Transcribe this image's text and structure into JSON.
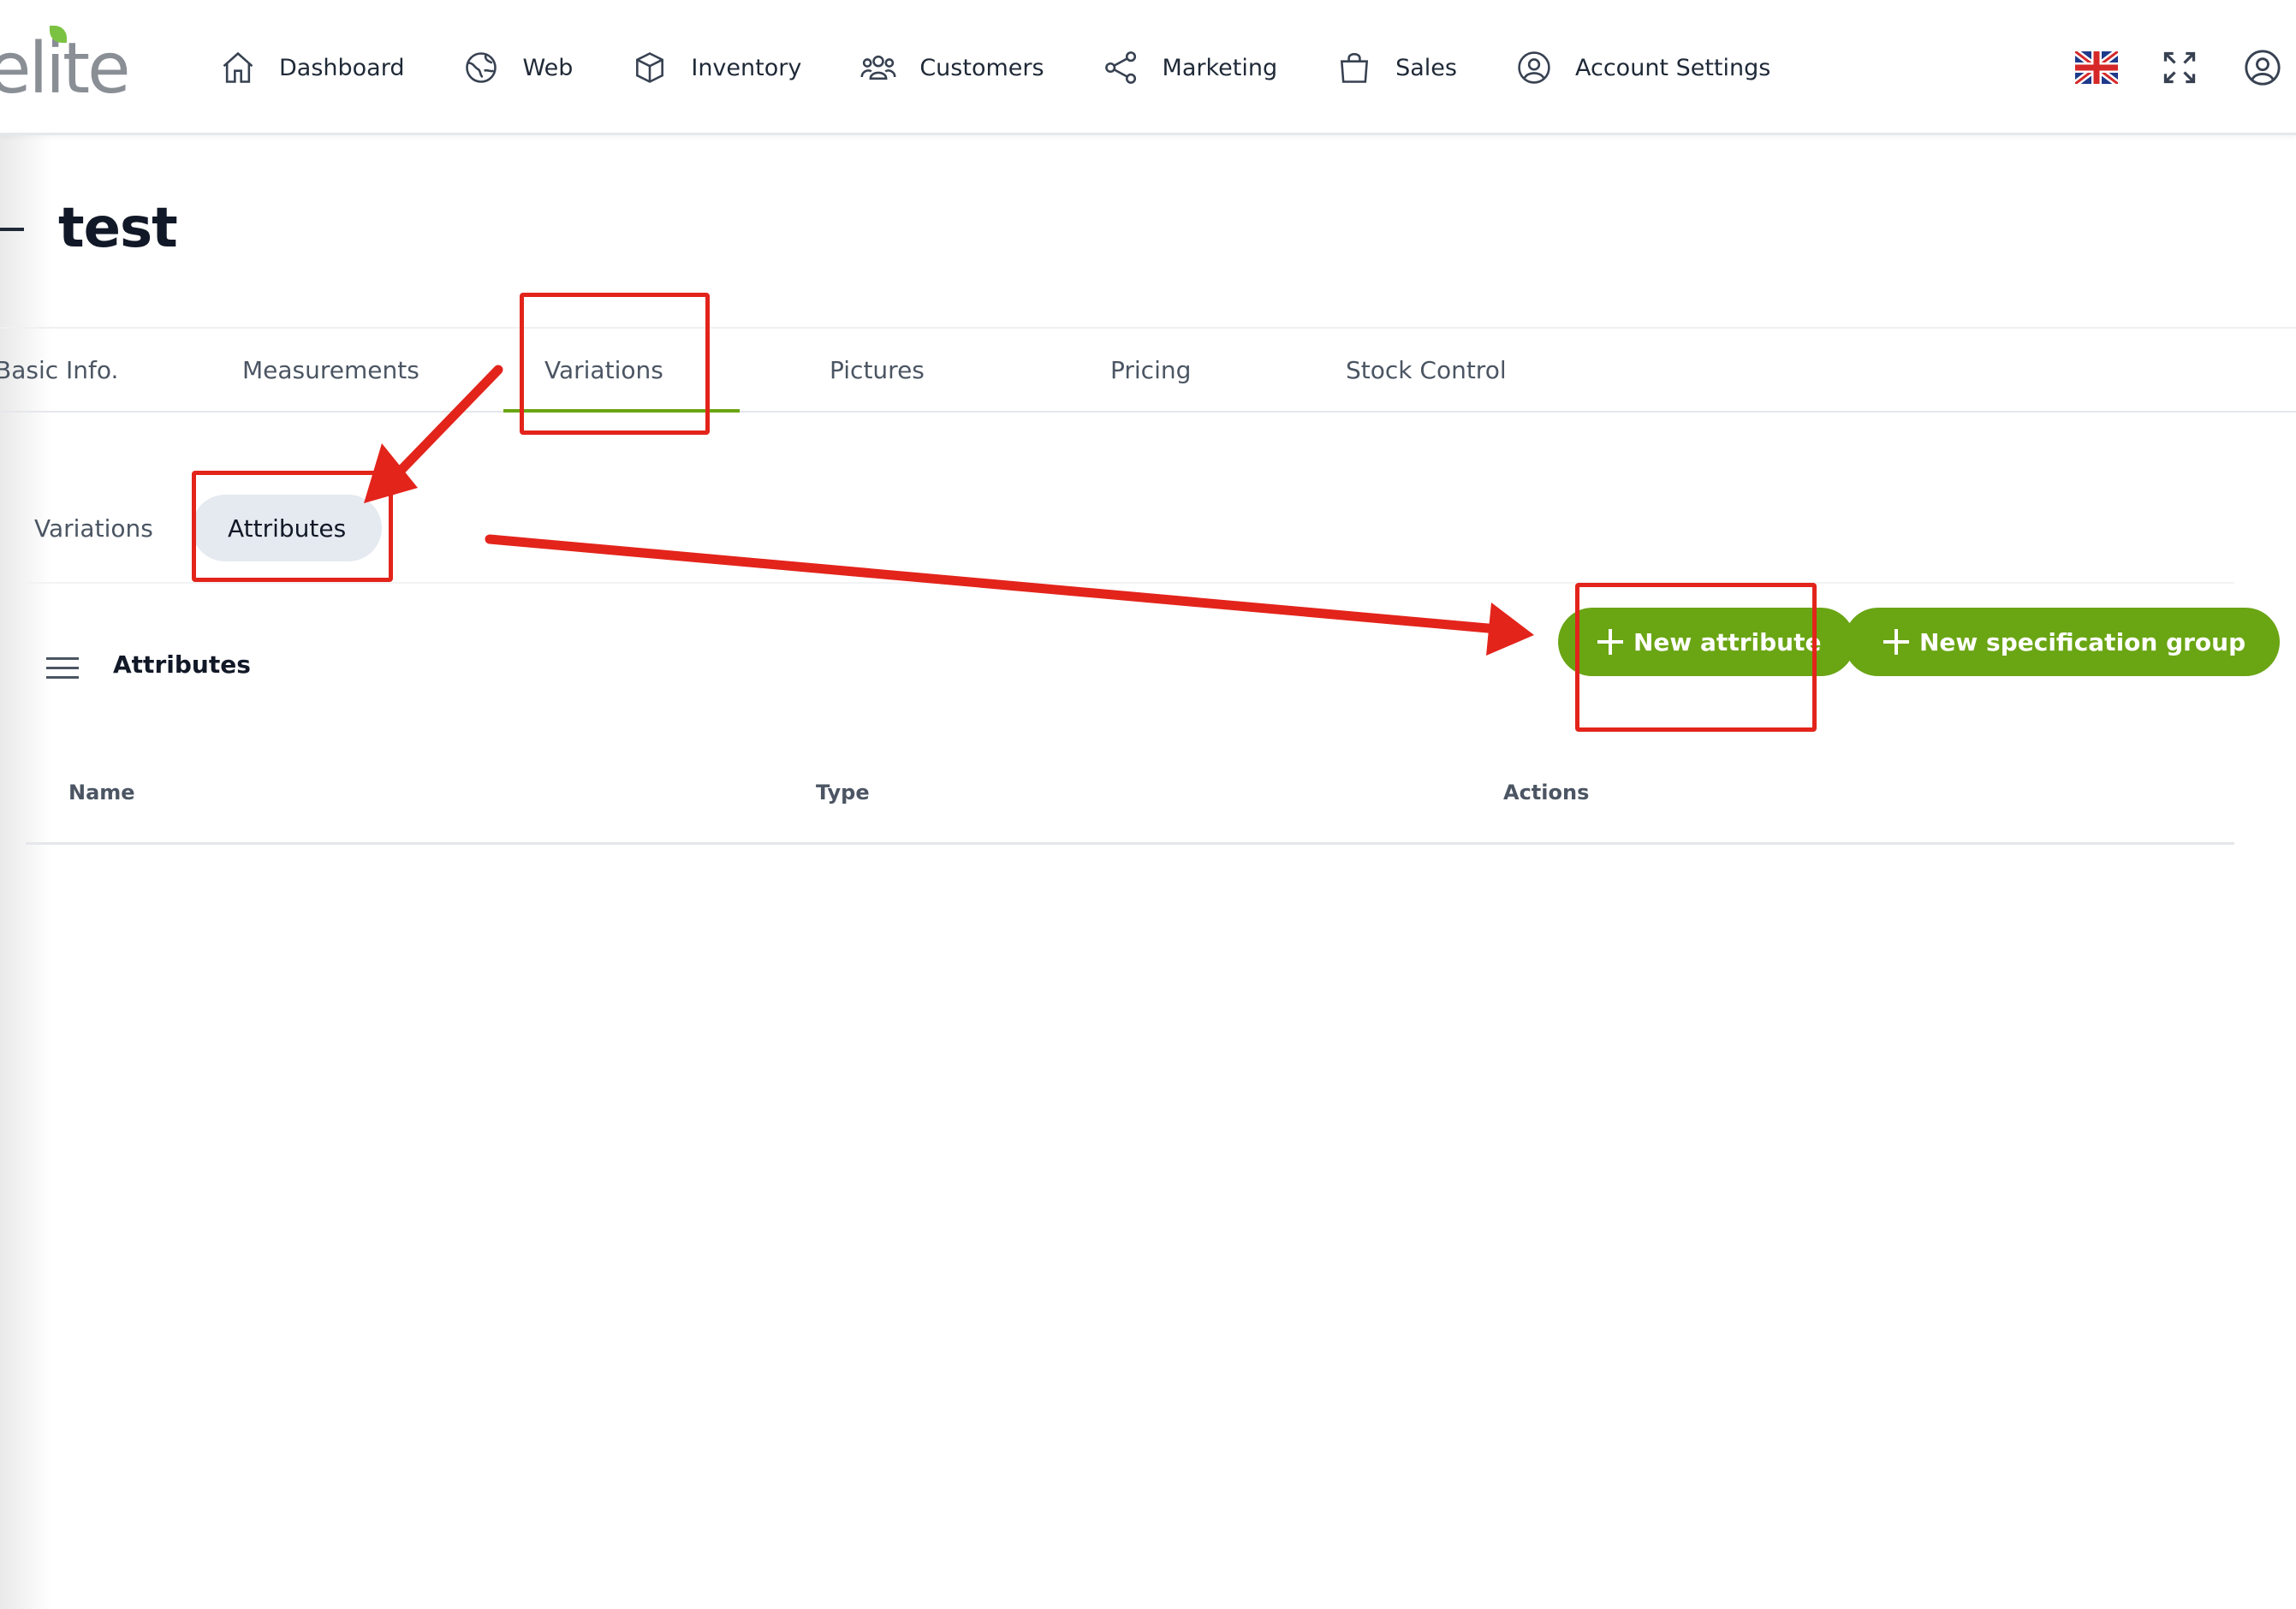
{
  "app": {
    "logo_text": "elite"
  },
  "nav": [
    {
      "label": "Dashboard",
      "icon": "home-icon"
    },
    {
      "label": "Web",
      "icon": "globe-icon"
    },
    {
      "label": "Inventory",
      "icon": "box-icon"
    },
    {
      "label": "Customers",
      "icon": "users-icon"
    },
    {
      "label": "Marketing",
      "icon": "share-icon"
    },
    {
      "label": "Sales",
      "icon": "shopping-bag-icon"
    },
    {
      "label": "Account Settings",
      "icon": "user-circle-icon"
    }
  ],
  "top_right": {
    "language_icon": "uk-flag-icon",
    "fullscreen_icon": "expand-icon",
    "account_icon": "user-circle-icon"
  },
  "page": {
    "title": "test"
  },
  "tabs": [
    {
      "label": "Basic Info."
    },
    {
      "label": "Measurements"
    },
    {
      "label": "Variations",
      "active": true
    },
    {
      "label": "Pictures"
    },
    {
      "label": "Pricing"
    },
    {
      "label": "Stock Control"
    }
  ],
  "subtabs": [
    {
      "label": "Variations"
    },
    {
      "label": "Attributes",
      "active": true
    }
  ],
  "panel": {
    "title": "Attributes",
    "new_attribute_label": "New attribute",
    "new_spec_group_label": "New specification group",
    "columns": [
      "Name",
      "Type",
      "Actions"
    ]
  },
  "colors": {
    "accent": "#6aa514",
    "annotation": "#e3241b",
    "subtab_active_bg": "#e5e9f0"
  }
}
